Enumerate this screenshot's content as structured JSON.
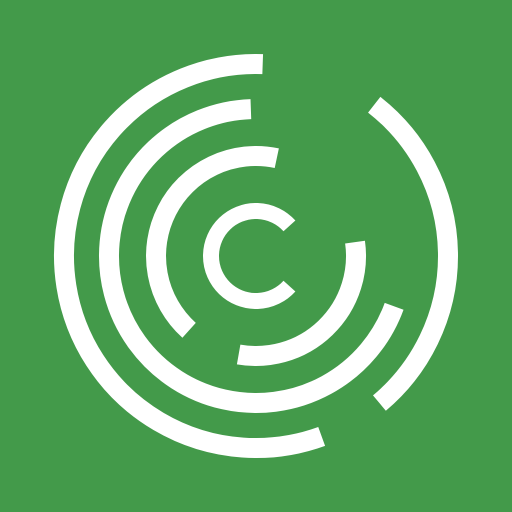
{
  "icon": {
    "name": "concentric-arcs-logo-icon",
    "background_color": "#439a4a",
    "foreground_color": "#ffffff"
  }
}
